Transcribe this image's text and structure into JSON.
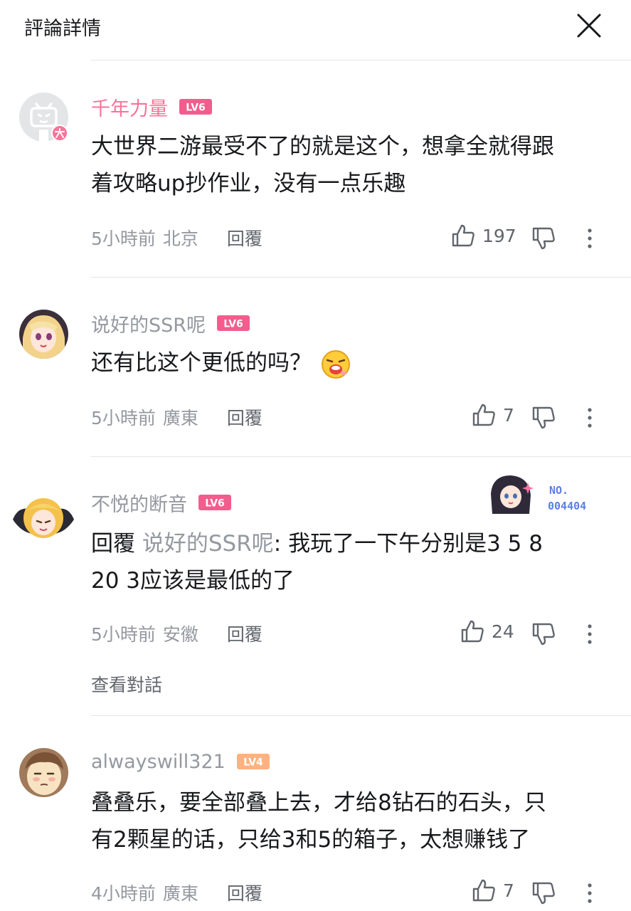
{
  "header": {
    "title": "評論詳情"
  },
  "comments": [
    {
      "username": "千年力量",
      "level": "LV6",
      "lines": [
        "大世界二游最受不了的就是这个，想拿全就得跟",
        "着攻略up抄作业，没有一点乐趣"
      ],
      "time": "5小時前",
      "location": "北京",
      "reply_label": "回覆",
      "likes": "197"
    },
    {
      "username": "说好的SSR呢",
      "level": "LV6",
      "lines": [
        "还有比这个更低的吗？"
      ],
      "time": "5小時前",
      "location": "廣東",
      "reply_label": "回覆",
      "likes": "7"
    },
    {
      "username": "不悦的断音",
      "level": "LV6",
      "reply_prefix": "回覆",
      "reply_to": "说好的SSR呢",
      "lines": [
        ": 我玩了一下午分别是3 5 8",
        "20 3应该是最低的了"
      ],
      "time": "5小時前",
      "location": "安徽",
      "reply_label": "回覆",
      "likes": "24",
      "view_conversation": "查看對話",
      "badge_label": "NO.",
      "badge_number": "004404"
    },
    {
      "username": "alwayswill321",
      "level": "LV4",
      "lines": [
        "叠叠乐，要全部叠上去，才给8钻石的石头，只",
        "有2颗星的话，只给3和5的箱子，太想赚钱了"
      ],
      "time": "4小時前",
      "location": "廣東",
      "reply_label": "回覆",
      "likes": "7"
    }
  ],
  "colors": {
    "vip_name": "#fb7299",
    "level6": "#f25d8e",
    "level4": "#ffb27f",
    "secondary_text": "#9499a0"
  }
}
